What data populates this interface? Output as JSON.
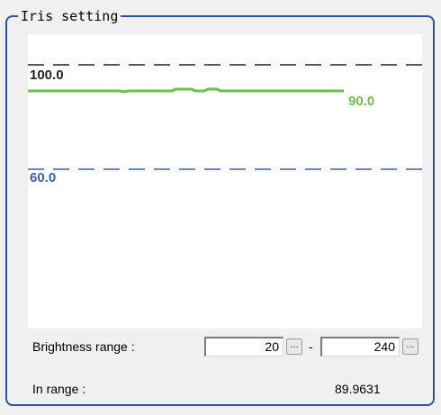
{
  "group": {
    "title": "Iris setting"
  },
  "graph": {
    "upper_label": "100.0",
    "current_label": "90.0",
    "lower_label": "60.0",
    "colors": {
      "upper": "#222222",
      "current": "#6cbf4a",
      "lower": "#3a5fb0"
    }
  },
  "brightness": {
    "label": "Brightness range :",
    "min": "20",
    "max": "240",
    "separator": "-",
    "button_label": "..."
  },
  "status": {
    "label": "In range :",
    "value": "89.9631"
  }
}
